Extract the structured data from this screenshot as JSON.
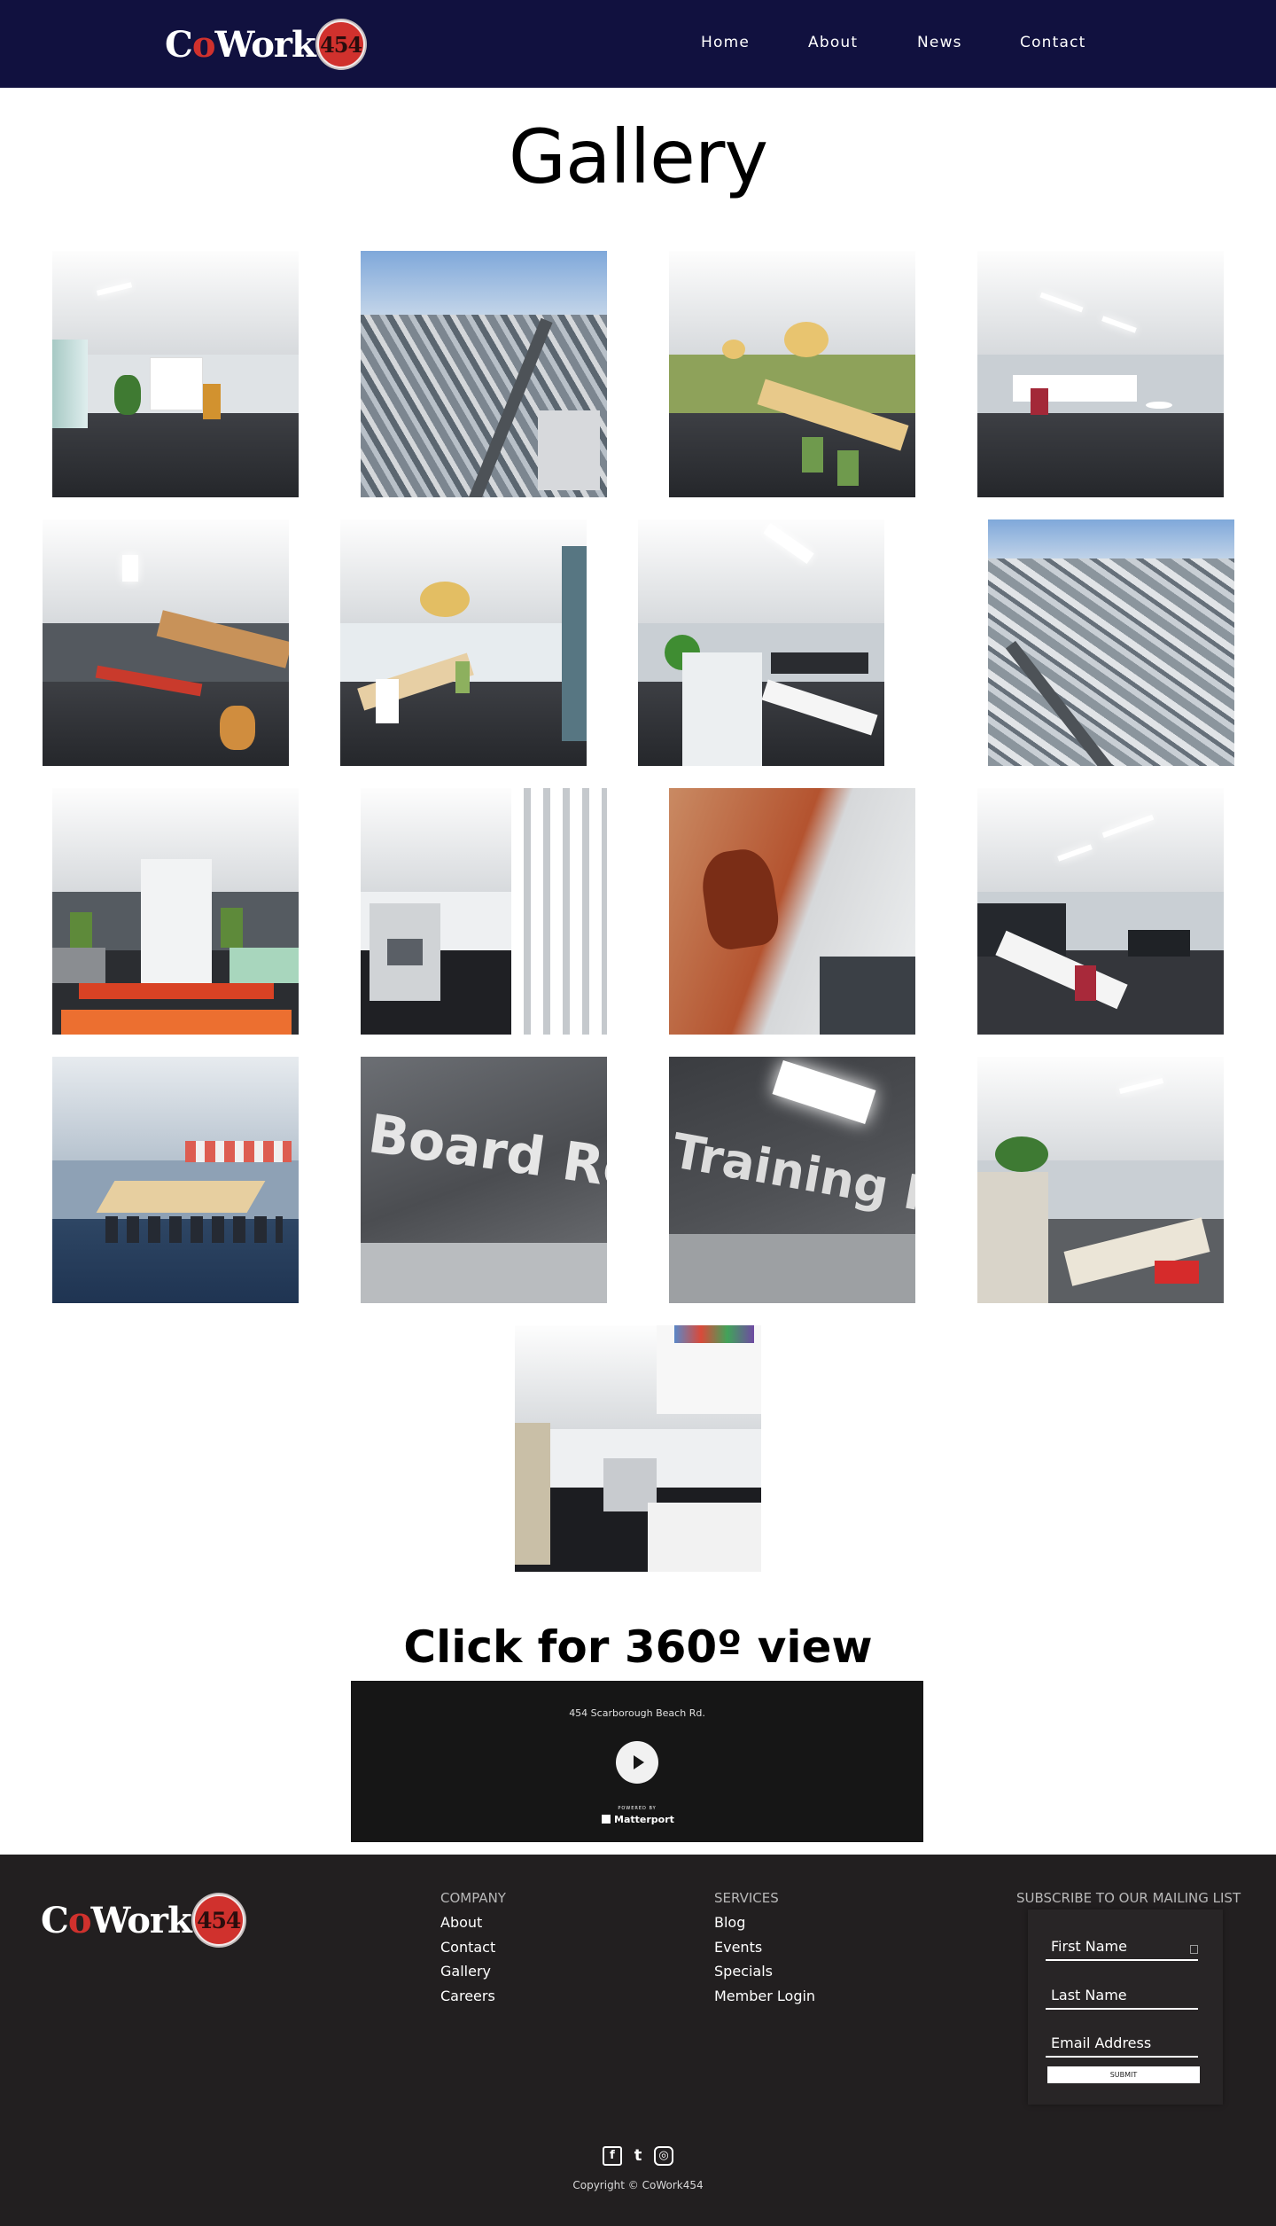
{
  "header": {
    "logo": {
      "text_co": "Co",
      "text_o": "o",
      "text_work": "Work",
      "badge": "454"
    },
    "nav": [
      {
        "label": "Home"
      },
      {
        "label": "About"
      },
      {
        "label": "News"
      },
      {
        "label": "Contact"
      }
    ]
  },
  "gallery": {
    "title": "Gallery",
    "photos": [
      "reception-icon",
      "aerial-city-icon",
      "kitchen-icon",
      "open-office-icon",
      "corridor-desks-icon",
      "breakout-area-icon",
      "workstations-icon",
      "aerial-industrial-icon",
      "hallway-icon",
      "print-room-icon",
      "hand-artwork-icon",
      "desk-area-icon",
      "boardroom-table-icon",
      "board-room-sign-icon",
      "training-room-sign-icon",
      "cubicles-icon",
      "storage-room-icon"
    ],
    "signs": {
      "board": "Board Room",
      "training": "Training Room"
    }
  },
  "tour": {
    "title": "Click for 360º view",
    "address": "454 Scarborough Beach Rd.",
    "powered": "POWERED BY",
    "brand": "Matterport"
  },
  "footer": {
    "logo": {
      "text_c": "C",
      "text_o": "o",
      "text_work": "Work",
      "badge": "454"
    },
    "company": {
      "heading": "COMPANY",
      "links": [
        "About",
        "Contact",
        "Gallery",
        "Careers"
      ]
    },
    "services": {
      "heading": "SERVICES",
      "links": [
        "Blog",
        "Events",
        "Specials",
        "Member Login"
      ]
    },
    "subscribe": {
      "heading": "SUBSCRIBE TO OUR MAILING LIST",
      "first_name": "First Name",
      "last_name": "Last Name",
      "email": "Email Address",
      "submit": "SUBMIT"
    },
    "social": {
      "facebook": "f",
      "twitter": "t",
      "instagram": "◎"
    },
    "copyright": "Copyright © CoWork454"
  },
  "colors": {
    "header_bg": "#11113f",
    "footer_bg": "#221f20",
    "brand_red": "#d0312d"
  }
}
